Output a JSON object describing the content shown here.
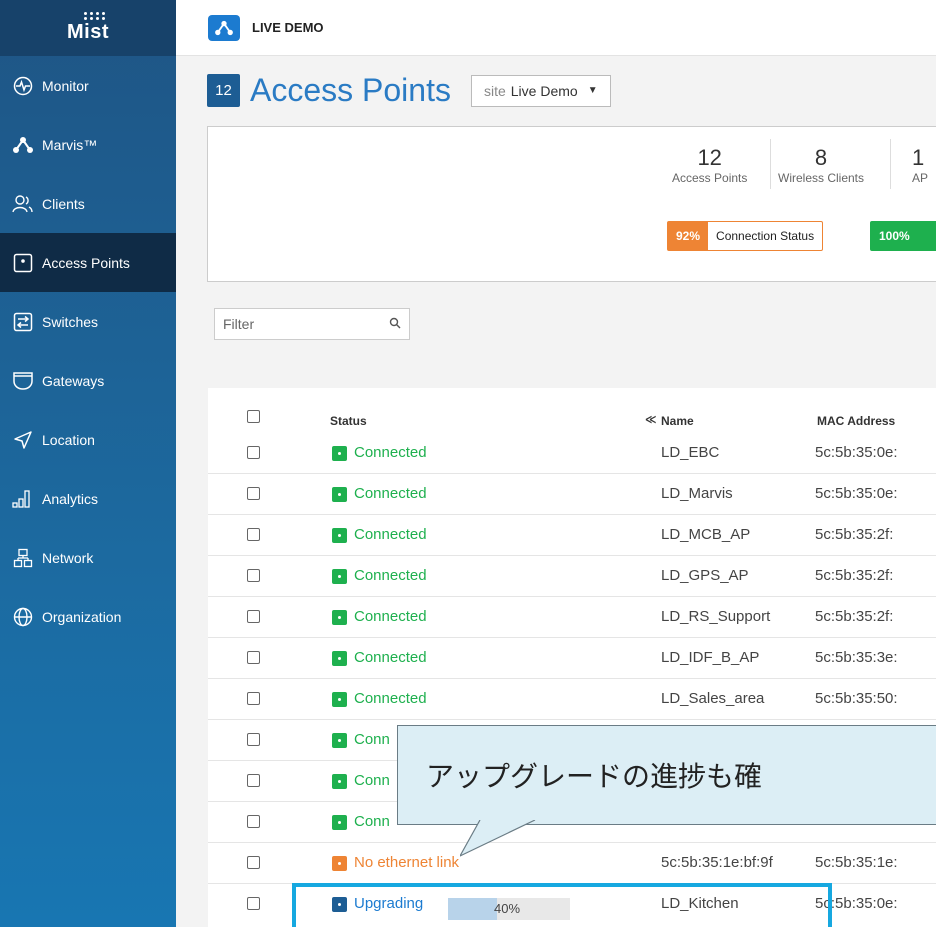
{
  "app": {
    "logo_text": "Mist",
    "org_name": "LIVE DEMO"
  },
  "sidebar": {
    "items": [
      {
        "label": "Monitor",
        "icon": "monitor-icon"
      },
      {
        "label": "Marvis™",
        "icon": "marvis-icon"
      },
      {
        "label": "Clients",
        "icon": "clients-icon"
      },
      {
        "label": "Access Points",
        "icon": "access-point-icon",
        "active": true
      },
      {
        "label": "Switches",
        "icon": "switch-icon"
      },
      {
        "label": "Gateways",
        "icon": "gateway-icon"
      },
      {
        "label": "Location",
        "icon": "location-icon"
      },
      {
        "label": "Analytics",
        "icon": "analytics-icon"
      },
      {
        "label": "Network",
        "icon": "network-icon"
      },
      {
        "label": "Organization",
        "icon": "globe-icon"
      }
    ]
  },
  "header": {
    "count": "12",
    "title": "Access Points",
    "site_label": "site",
    "site_value": "Live Demo"
  },
  "stats": {
    "ap_count": "12",
    "ap_label": "Access Points",
    "clients_count": "8",
    "clients_label": "Wireless Clients",
    "third_count": "1",
    "third_label": "AP",
    "connection_pct": "92%",
    "connection_label": "Connection Status",
    "second_pct": "100%"
  },
  "filter": {
    "placeholder": "Filter"
  },
  "table": {
    "headers": {
      "status": "Status",
      "name": "Name",
      "mac": "MAC Address"
    },
    "rows": [
      {
        "status": "Connected",
        "name": "LD_EBC",
        "mac": "5c:5b:35:0e:"
      },
      {
        "status": "Connected",
        "name": "LD_Marvis",
        "mac": "5c:5b:35:0e:"
      },
      {
        "status": "Connected",
        "name": "LD_MCB_AP",
        "mac": "5c:5b:35:2f:"
      },
      {
        "status": "Connected",
        "name": "LD_GPS_AP",
        "mac": "5c:5b:35:2f:"
      },
      {
        "status": "Connected",
        "name": "LD_RS_Support",
        "mac": "5c:5b:35:2f:"
      },
      {
        "status": "Connected",
        "name": "LD_IDF_B_AP",
        "mac": "5c:5b:35:3e:"
      },
      {
        "status": "Connected",
        "name": "LD_Sales_area",
        "mac": "5c:5b:35:50:"
      },
      {
        "status": "Conn",
        "name": "",
        "mac": ""
      },
      {
        "status": "Conn",
        "name": "",
        "mac": ""
      },
      {
        "status": "Conn",
        "name": "",
        "mac": ""
      },
      {
        "status": "No ethernet link",
        "name": "5c:5b:35:1e:bf:9f",
        "mac": "5c:5b:35:1e:"
      },
      {
        "status": "Upgrading",
        "name": "LD_Kitchen",
        "mac": "5c:5b:35:0e:",
        "progress_pct": "40%",
        "progress": 0.4
      }
    ]
  },
  "callout": {
    "text": "アップグレードの進捗も確"
  },
  "colors": {
    "connected": "#1eb04e",
    "warning": "#ee8434",
    "upgrading": "#1d5d94",
    "accent": "#2a7bc4"
  }
}
